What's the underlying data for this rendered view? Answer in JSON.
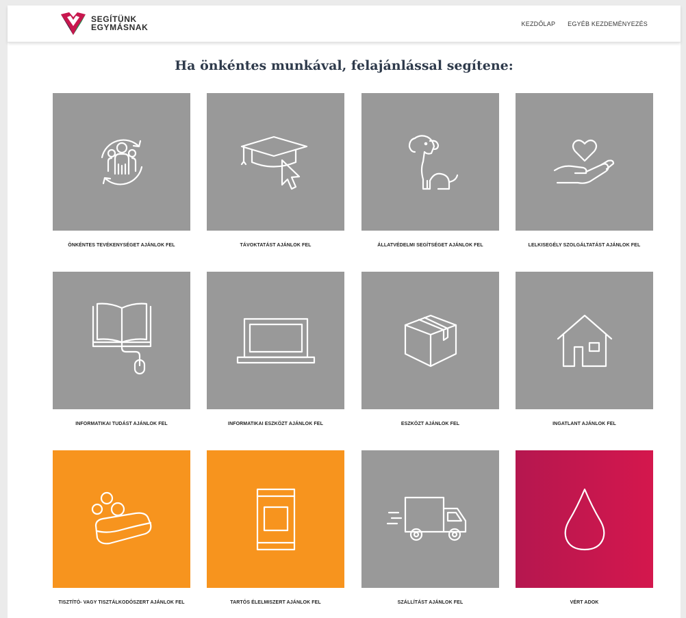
{
  "header": {
    "logo_line1": "SEGÍTÜNK",
    "logo_line2": "EGYMÁSNAK",
    "nav": [
      "KEZDŐLAP",
      "EGYÉB KEZDEMÉNYEZÉS"
    ]
  },
  "main": {
    "title": "Ha önkéntes munkával, felajánlással segítene:"
  },
  "cards": [
    {
      "label": "ÖNKÉNTES TEVÉKENYSÉGET AJÁNLOK FEL",
      "icon": "volunteers-icon",
      "color": "#999999"
    },
    {
      "label": "TÁVOKTATÁST AJÁNLOK FEL",
      "icon": "graduation-cap-cursor-icon",
      "color": "#999999"
    },
    {
      "label": "ÁLLATVÉDELMI SEGÍTSÉGET AJÁNLOK FEL",
      "icon": "dog-icon",
      "color": "#999999"
    },
    {
      "label": "LELKISEGÉLY SZOLGÁLTATÁST AJÁNLOK FEL",
      "icon": "heart-in-hand-icon",
      "color": "#999999"
    },
    {
      "label": "INFORMATIKAI TUDÁST AJÁNLOK FEL",
      "icon": "book-mouse-icon",
      "color": "#999999"
    },
    {
      "label": "INFORMATIKAI ESZKÖZT AJÁNLOK FEL",
      "icon": "laptop-icon",
      "color": "#999999"
    },
    {
      "label": "ESZKÖZT AJÁNLOK FEL",
      "icon": "box-icon",
      "color": "#999999"
    },
    {
      "label": "INGATLANT AJÁNLOK FEL",
      "icon": "house-icon",
      "color": "#999999"
    },
    {
      "label": "TISZTÍTÓ- VAGY TISZTÁLKODÓSZERT AJÁNLOK FEL",
      "icon": "soap-bubbles-icon",
      "color": "#f7941e"
    },
    {
      "label": "TARTÓS ÉLELMISZERT AJÁNLOK FEL",
      "icon": "canned-food-icon",
      "color": "#f7941e"
    },
    {
      "label": "SZÁLLÍTÁST AJÁNLOK FEL",
      "icon": "delivery-truck-icon",
      "color": "#999999"
    },
    {
      "label": "VÉRT ADOK",
      "icon": "blood-drop-icon",
      "color": "#c8174e"
    }
  ]
}
